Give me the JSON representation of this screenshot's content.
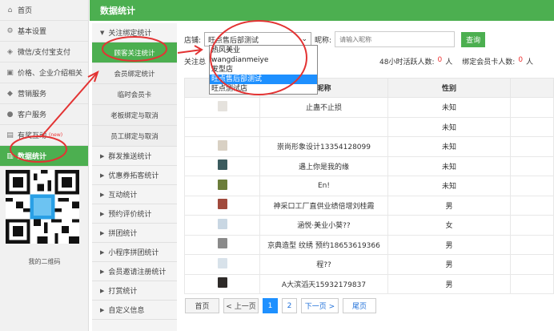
{
  "sidebar": {
    "items": [
      {
        "label": "首页",
        "icon": "home-icon",
        "glyph": "⌂"
      },
      {
        "label": "基本设置",
        "icon": "gear-icon",
        "glyph": "⚙"
      },
      {
        "label": "微信/支付宝支付",
        "icon": "shield-icon",
        "glyph": "◈"
      },
      {
        "label": "价格、企业介绍相关",
        "icon": "document-icon",
        "glyph": "▣"
      },
      {
        "label": "营销服务",
        "icon": "tag-icon",
        "glyph": "◆"
      },
      {
        "label": "客户服务",
        "icon": "person-icon",
        "glyph": "●"
      },
      {
        "label": "有奖互动",
        "icon": "gift-icon",
        "glyph": "▤",
        "badge": "(new)"
      },
      {
        "label": "数据统计",
        "icon": "chart-icon",
        "glyph": "▥",
        "active": true
      }
    ],
    "qr_label": "我的二维码"
  },
  "header": {
    "title": "数据统计"
  },
  "submenu": {
    "group_open": "关注绑定统计",
    "items": [
      {
        "label": "顾客关注统计",
        "active": true
      },
      {
        "label": "会员绑定统计"
      },
      {
        "label": "临时会员卡"
      },
      {
        "label": "老板绑定与取消"
      },
      {
        "label": "员工绑定与取消"
      }
    ],
    "groups": [
      "群发推送统计",
      "优惠券拓客统计",
      "互动统计",
      "预约评价统计",
      "拼团统计",
      "小程序拼团统计",
      "会员邀请注册统计",
      "打赏统计",
      "自定义信息"
    ]
  },
  "filters": {
    "store_label": "店铺:",
    "store_value": "旺点售后部测试",
    "store_options": [
      "热风美业",
      "wangdianmeiye",
      "发型店",
      "旺点售后部测试",
      "旺点测试店"
    ],
    "nickname_label": "昵称:",
    "nickname_placeholder": "请输入昵称",
    "query_label": "查询"
  },
  "stats": {
    "total_prefix": "关注总",
    "active48_label": "48小时活跃人数:",
    "active48_value": "0",
    "unit": "人",
    "bound_label": "绑定会员卡人数:",
    "bound_value": "0"
  },
  "table": {
    "headers": [
      "",
      "昵称",
      "性别"
    ],
    "rows": [
      {
        "nick": "止蛊不止损",
        "gender": "未知",
        "avatar_color": "#e5e2dd"
      },
      {
        "nick": "",
        "gender": "未知",
        "avatar_color": ""
      },
      {
        "nick": "崇尚形象设计13354128099",
        "gender": "未知",
        "avatar_color": "#d9d1c4"
      },
      {
        "nick": "遇上你是我的缘",
        "gender": "未知",
        "avatar_color": "#3b5b5e"
      },
      {
        "nick": "En!",
        "gender": "未知",
        "avatar_color": "#6b7d3a"
      },
      {
        "nick": "神采口工厂直供业绩倍增刘桂霞",
        "gender": "男",
        "avatar_color": "#a14a3c"
      },
      {
        "nick": "涵悦·美业小葵??",
        "gender": "女",
        "avatar_color": "#c9d7e3"
      },
      {
        "nick": "京典造型 纹绣 预约18653619366",
        "gender": "男",
        "avatar_color": "#8a8a8a"
      },
      {
        "nick": "程??",
        "gender": "男",
        "avatar_color": "#d8e2ea"
      },
      {
        "nick": "A大滨滔天15932179837",
        "gender": "男",
        "avatar_color": "#2e2a28"
      }
    ]
  },
  "pagination": {
    "first": "首页",
    "prev": "< 上一页",
    "pages": [
      "1",
      "2"
    ],
    "current": "1",
    "next": "下一页 >",
    "last": "尾页"
  },
  "colors": {
    "accent": "#4caf50",
    "highlight": "#e33333",
    "selected": "#1e90ff"
  }
}
